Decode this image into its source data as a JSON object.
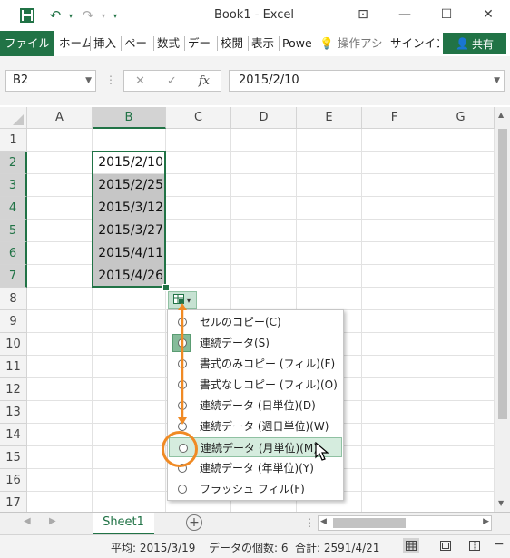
{
  "window": {
    "title": "Book1 - Excel"
  },
  "ribbon": {
    "file_tab": "ファイル",
    "tabs": [
      "ホーム",
      "挿入",
      "ペー",
      "数式",
      "デー",
      "校閲",
      "表示",
      "Powe"
    ],
    "tell_me": "操作アシ",
    "sign_in": "サインイン",
    "share": "共有"
  },
  "formula_bar": {
    "name_box": "B2",
    "fx_label": "fx",
    "formula": "2015/2/10"
  },
  "columns": [
    "A",
    "B",
    "C",
    "D",
    "E",
    "F",
    "G"
  ],
  "rows": [
    "1",
    "2",
    "3",
    "4",
    "5",
    "6",
    "7",
    "8",
    "9",
    "10",
    "11",
    "12",
    "13",
    "14",
    "15",
    "16",
    "17"
  ],
  "cells_B": [
    "2015/2/10",
    "2015/2/25",
    "2015/3/12",
    "2015/3/27",
    "2015/4/11",
    "2015/4/26"
  ],
  "autofill_menu": {
    "items": [
      {
        "label": "セルのコピー(C)",
        "checked": false
      },
      {
        "label": "連続データ(S)",
        "checked": true
      },
      {
        "label": "書式のみコピー (フィル)(F)",
        "checked": false
      },
      {
        "label": "書式なしコピー (フィル)(O)",
        "checked": false
      },
      {
        "label": "連続データ (日単位)(D)",
        "checked": false
      },
      {
        "label": "連続データ (週日単位)(W)",
        "checked": false
      },
      {
        "label": "連続データ (月単位)(M)",
        "checked": false
      },
      {
        "label": "連続データ (年単位)(Y)",
        "checked": false
      },
      {
        "label": "フラッシュ フィル(F)",
        "checked": false
      }
    ],
    "hovered_index": 6
  },
  "sheet_tabs": {
    "active": "Sheet1"
  },
  "status_bar": {
    "average": "平均: 2015/3/19",
    "count": "データの個数: 6",
    "sum": "合計: 2591/4/21"
  },
  "colors": {
    "accent": "#217346",
    "annotation": "#f08a24"
  }
}
